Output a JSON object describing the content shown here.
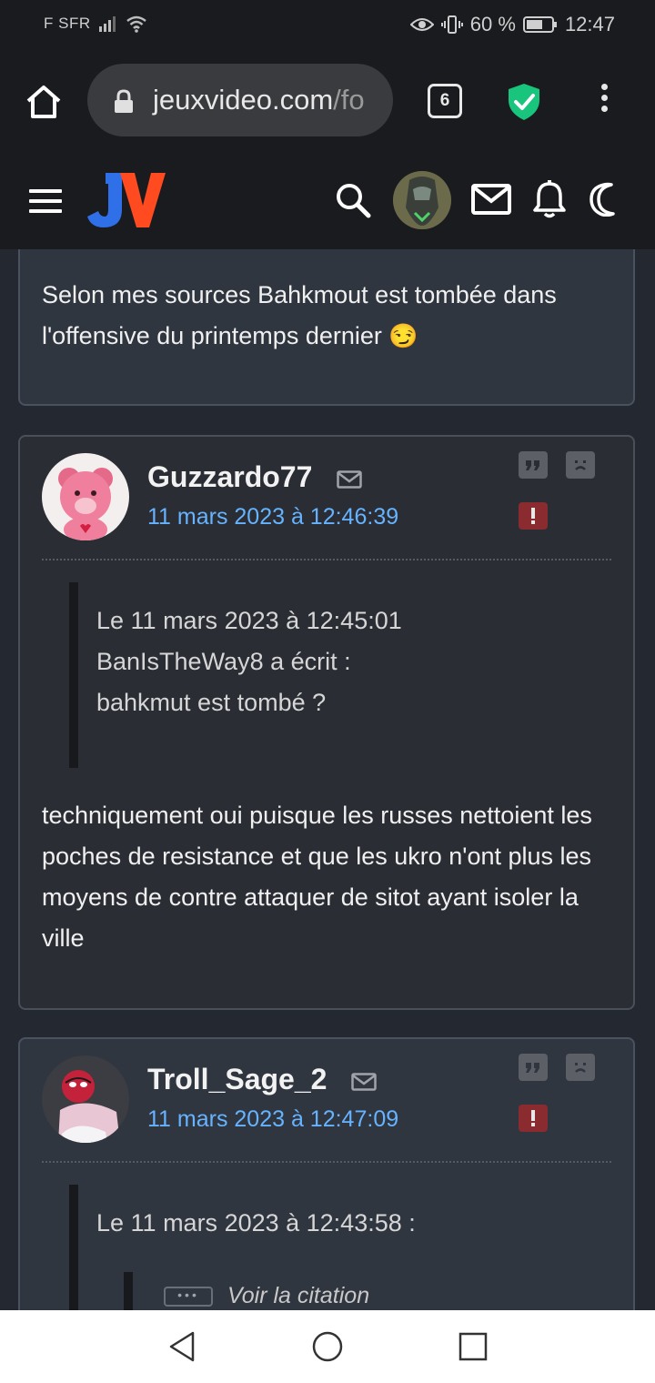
{
  "status_bar": {
    "carrier": "F SFR",
    "battery": "60 %",
    "time": "12:47"
  },
  "browser": {
    "url_main": "jeuxvideo.com",
    "url_rest": "/fo",
    "tab_count": "6"
  },
  "site": {
    "logo_text": "JV"
  },
  "posts": [
    {
      "body": "Selon mes sources Bahkmout est tombée dans l'offensive du printemps dernier",
      "emoji": "😏"
    },
    {
      "author": "Guzzardo77",
      "date": "11 mars 2023 à 12:46:39",
      "quote_lines": [
        "Le 11 mars 2023 à 12:45:01",
        "BanIsTheWay8 a écrit :",
        "bahkmut est tombé ?"
      ],
      "body": "techniquement oui puisque les russes nettoient les poches de resistance et que les ukro n'ont plus les moyens de contre attaquer de sitot ayant isoler la ville"
    },
    {
      "author": "Troll_Sage_2",
      "date": "11 mars 2023 à 12:47:09",
      "quote_header": "Le 11 mars 2023 à 12:43:58 :",
      "nested_quote_label": "Voir la citation"
    }
  ],
  "icons": {
    "home": "home-icon",
    "lock": "lock-icon",
    "shield": "shield-check-icon",
    "menu": "hamburger-icon",
    "search": "search-icon",
    "mail": "mail-icon",
    "bell": "bell-icon",
    "moon": "moon-icon",
    "quote": "quote-icon",
    "sad": "sad-face-icon",
    "alert": "exclamation-icon"
  },
  "colors": {
    "background": "#242830",
    "date_link": "#66b3ff",
    "alert_badge": "#8a2b30",
    "shield": "#19c47d"
  }
}
